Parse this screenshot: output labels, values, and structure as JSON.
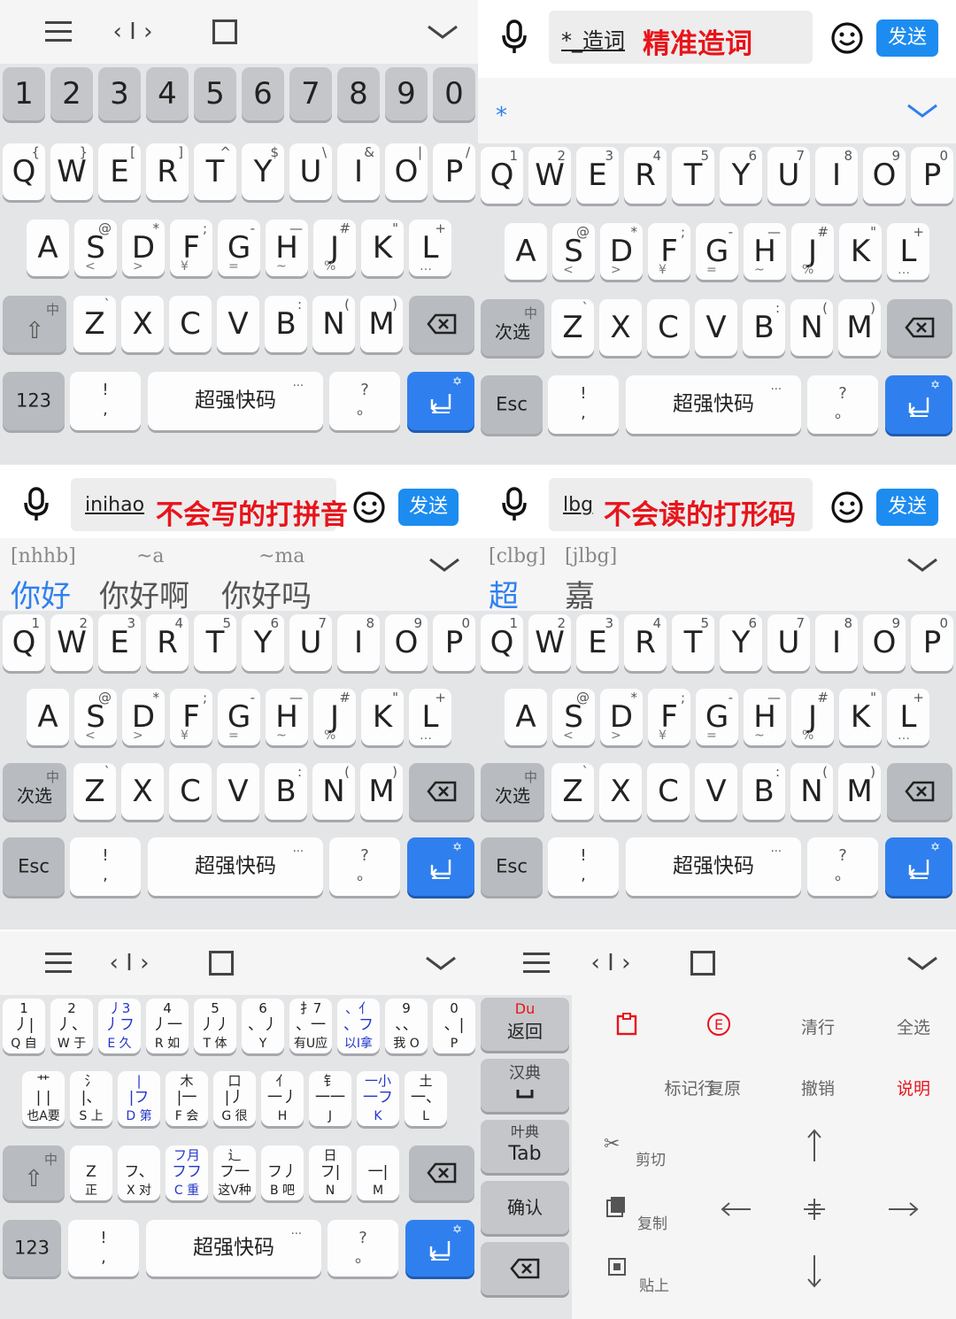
{
  "toolbar": {
    "menu_icon": "menu-icon",
    "cursor_icon": "cursor-icon",
    "layout_icon": "square-icon",
    "collapse_icon": "chevron-down-icon"
  },
  "number_row": [
    "1",
    "2",
    "3",
    "4",
    "5",
    "6",
    "7",
    "8",
    "9",
    "0"
  ],
  "row_q": [
    {
      "k": "Q",
      "sym": "{",
      "num": "1"
    },
    {
      "k": "W",
      "sym": "}",
      "num": "2"
    },
    {
      "k": "E",
      "sym": "[",
      "num": "3"
    },
    {
      "k": "R",
      "sym": "]",
      "num": "4"
    },
    {
      "k": "T",
      "sym": "^",
      "num": "5"
    },
    {
      "k": "Y",
      "sym": "$",
      "num": "6"
    },
    {
      "k": "U",
      "sym": "\\",
      "num": "7"
    },
    {
      "k": "I",
      "sym": "&",
      "num": "8"
    },
    {
      "k": "O",
      "sym": "|",
      "num": "9"
    },
    {
      "k": "P",
      "sym": "/",
      "num": "0"
    }
  ],
  "row_a": [
    {
      "k": "A",
      "sup": "",
      "sub": ""
    },
    {
      "k": "S",
      "sup": "@",
      "sub": "<"
    },
    {
      "k": "D",
      "sup": "*",
      "sub": ">"
    },
    {
      "k": "F",
      "sup": ";",
      "sub": "¥"
    },
    {
      "k": "G",
      "sup": "-",
      "sub": "="
    },
    {
      "k": "H",
      "sup": "—",
      "sub": "~"
    },
    {
      "k": "J",
      "sup": "#",
      "sub": "%"
    },
    {
      "k": "K",
      "sup": "\"",
      "sub": ""
    },
    {
      "k": "L",
      "sup": "+",
      "sub": "…"
    }
  ],
  "row_z": [
    {
      "k": "Z",
      "sup": "`"
    },
    {
      "k": "X",
      "sup": ""
    },
    {
      "k": "C",
      "sup": ""
    },
    {
      "k": "V",
      "sup": ""
    },
    {
      "k": "B",
      "sup": ":"
    },
    {
      "k": "N",
      "sup": "("
    },
    {
      "k": "M",
      "sup": ")"
    }
  ],
  "keys": {
    "shift_mode": "中",
    "shift": "⇧",
    "next_cand": "次选",
    "esc": "Esc",
    "num123": "123",
    "excl": "!",
    "comma": ",",
    "space": "超强快码",
    "ellipsis": "···",
    "question": "?",
    "period": "。",
    "enter": "⏎",
    "enter_star": "✡"
  },
  "p2": {
    "input": "*_造词",
    "caption": "精准造词",
    "send": "发送",
    "candidate": "*"
  },
  "p3": {
    "input": "inihao",
    "caption": "不会写的打拼音",
    "send": "发送",
    "candidates": [
      {
        "code": "[nhhb]",
        "word": "你好"
      },
      {
        "code": "~a",
        "word": "你好啊"
      },
      {
        "code": "~ma",
        "word": "你好吗"
      }
    ]
  },
  "p4": {
    "input": "lbg",
    "caption": "不会读的打形码",
    "send": "发送",
    "candidates": [
      {
        "code": "[clbg]",
        "word": "超"
      },
      {
        "code": "[jlbg]",
        "word": "嘉"
      }
    ]
  },
  "stroke_rows": [
    [
      {
        "t": "1",
        "s": "丿|",
        "b": "Q 自",
        "blue": false
      },
      {
        "t": "2",
        "s": "丿、",
        "b": "W 于",
        "blue": false
      },
      {
        "t": "丿3",
        "s": "丿フ",
        "b": "E 久",
        "blue": true
      },
      {
        "t": "4",
        "s": "丿一",
        "b": "R 如",
        "blue": false
      },
      {
        "t": "5",
        "s": "丿丿",
        "b": "T 体",
        "blue": false
      },
      {
        "t": "6",
        "s": "、丿",
        "b": "Y",
        "blue": false
      },
      {
        "t": "扌7",
        "s": "、一",
        "b": "有U应",
        "blue": false
      },
      {
        "t": "、亻",
        "s": "、フ",
        "b": "以I拿",
        "blue": true
      },
      {
        "t": "9",
        "s": "、、",
        "b": "我 O",
        "blue": false
      },
      {
        "t": "0",
        "s": "、|",
        "b": "P",
        "blue": false
      }
    ],
    [
      {
        "t": "艹",
        "s": "| |",
        "b": "也A要",
        "blue": false
      },
      {
        "t": "氵",
        "s": "|、",
        "b": "S 上",
        "blue": false
      },
      {
        "t": "|",
        "s": "|フ",
        "b": "D 第",
        "blue": true
      },
      {
        "t": "木",
        "s": "|一",
        "b": "F 会",
        "blue": false
      },
      {
        "t": "口",
        "s": "|丿",
        "b": "G 很",
        "blue": false
      },
      {
        "t": "亻",
        "s": "一丿",
        "b": "H",
        "blue": false
      },
      {
        "t": "钅",
        "s": "一一",
        "b": "J",
        "blue": false
      },
      {
        "t": "一小",
        "s": "一フ",
        "b": "K",
        "blue": true
      },
      {
        "t": "土",
        "s": "一、",
        "b": "L",
        "blue": false
      }
    ],
    [
      {
        "t": "",
        "s": "Z",
        "b": "正",
        "blue": false
      },
      {
        "t": "",
        "s": "フ、",
        "b": "X 对",
        "blue": false
      },
      {
        "t": "フ月",
        "s": "フフ",
        "b": "C 重",
        "blue": true
      },
      {
        "t": "辶",
        "s": "フ一",
        "b": "这V种",
        "blue": false
      },
      {
        "t": "",
        "s": "フ丿",
        "b": "B 吧",
        "blue": false
      },
      {
        "t": "日",
        "s": "フ|",
        "b": "N",
        "blue": false
      },
      {
        "t": "",
        "s": "一|",
        "b": "M",
        "blue": false
      }
    ]
  ],
  "edit": {
    "back": "返回",
    "back_sup": "Du",
    "han_dict": "汉典",
    "leaf_dict": "叶典",
    "tab": "Tab",
    "confirm": "确认",
    "clear_line": "清行",
    "select_all": "全选",
    "mark_line": "标记行",
    "restore": "复原",
    "undo": "撤销",
    "help": "说明",
    "cut": "剪切",
    "copy": "复制",
    "paste": "贴上",
    "e_circle": "E"
  }
}
